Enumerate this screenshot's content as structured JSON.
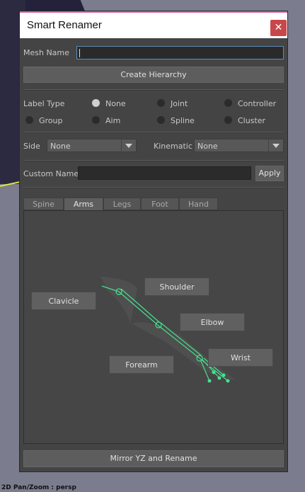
{
  "window": {
    "title": "Smart Renamer"
  },
  "mesh": {
    "label": "Mesh Name",
    "value": ""
  },
  "buttons": {
    "create_hierarchy": "Create Hierarchy",
    "apply": "Apply",
    "mirror": "Mirror YZ and Rename"
  },
  "label_type": {
    "label": "Label Type",
    "options": [
      "None",
      "Joint",
      "Controller",
      "Group",
      "Aim",
      "Spline",
      "Cluster"
    ],
    "selected": "None"
  },
  "side": {
    "label": "Side",
    "value": "None"
  },
  "kinematic": {
    "label": "Kinematic",
    "value": "None"
  },
  "custom_name": {
    "label": "Custom Name",
    "value": ""
  },
  "tabs": [
    "Spine",
    "Arms",
    "Legs",
    "Foot",
    "Hand"
  ],
  "active_tab": "Arms",
  "arm_joints": {
    "clavicle": "Clavicle",
    "shoulder": "Shoulder",
    "elbow": "Elbow",
    "forearm": "Forearm",
    "wrist": "Wrist"
  },
  "viewport": {
    "status": "2D Pan/Zoom : persp"
  },
  "colors": {
    "accent": "#c9474a",
    "rig": "#45e08f",
    "title_border": "#d06aa8"
  }
}
